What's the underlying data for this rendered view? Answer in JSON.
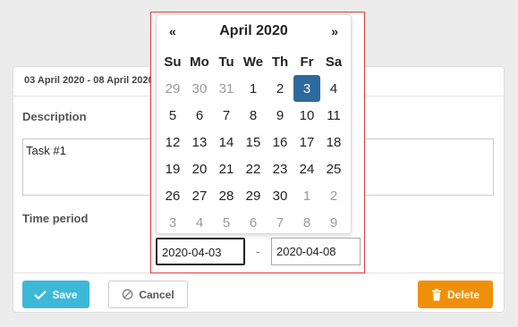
{
  "card": {
    "title": "03 April 2020 - 08 April 2020",
    "description_label": "Description",
    "description_value": "Task #1",
    "time_period_label": "Time period"
  },
  "buttons": {
    "save": "Save",
    "cancel": "Cancel",
    "delete": "Delete"
  },
  "datepicker": {
    "prev": "«",
    "next": "»",
    "month": "April 2020",
    "weekdays": [
      "Su",
      "Mo",
      "Tu",
      "We",
      "Th",
      "Fr",
      "Sa"
    ],
    "weeks": [
      [
        {
          "d": "29",
          "m": true
        },
        {
          "d": "30",
          "m": true
        },
        {
          "d": "31",
          "m": true
        },
        {
          "d": "1"
        },
        {
          "d": "2"
        },
        {
          "d": "3",
          "sel": true
        },
        {
          "d": "4"
        }
      ],
      [
        {
          "d": "5"
        },
        {
          "d": "6"
        },
        {
          "d": "7"
        },
        {
          "d": "8"
        },
        {
          "d": "9"
        },
        {
          "d": "10"
        },
        {
          "d": "11"
        }
      ],
      [
        {
          "d": "12"
        },
        {
          "d": "13"
        },
        {
          "d": "14"
        },
        {
          "d": "15"
        },
        {
          "d": "16"
        },
        {
          "d": "17"
        },
        {
          "d": "18"
        }
      ],
      [
        {
          "d": "19"
        },
        {
          "d": "20"
        },
        {
          "d": "21"
        },
        {
          "d": "22"
        },
        {
          "d": "23"
        },
        {
          "d": "24"
        },
        {
          "d": "25"
        }
      ],
      [
        {
          "d": "26"
        },
        {
          "d": "27"
        },
        {
          "d": "28"
        },
        {
          "d": "29"
        },
        {
          "d": "30"
        },
        {
          "d": "1",
          "m": true
        },
        {
          "d": "2",
          "m": true
        }
      ],
      [
        {
          "d": "3",
          "m": true
        },
        {
          "d": "4",
          "m": true
        },
        {
          "d": "5",
          "m": true
        },
        {
          "d": "6",
          "m": true
        },
        {
          "d": "7",
          "m": true
        },
        {
          "d": "8",
          "m": true
        },
        {
          "d": "9",
          "m": true
        }
      ]
    ],
    "start_date": "2020-04-03",
    "separator": "-",
    "end_date": "2020-04-08"
  },
  "colors": {
    "save": "#3db8d8",
    "delete": "#f0900a",
    "selected_day": "#2d6a9d",
    "highlight_border": "#e23a3a"
  }
}
